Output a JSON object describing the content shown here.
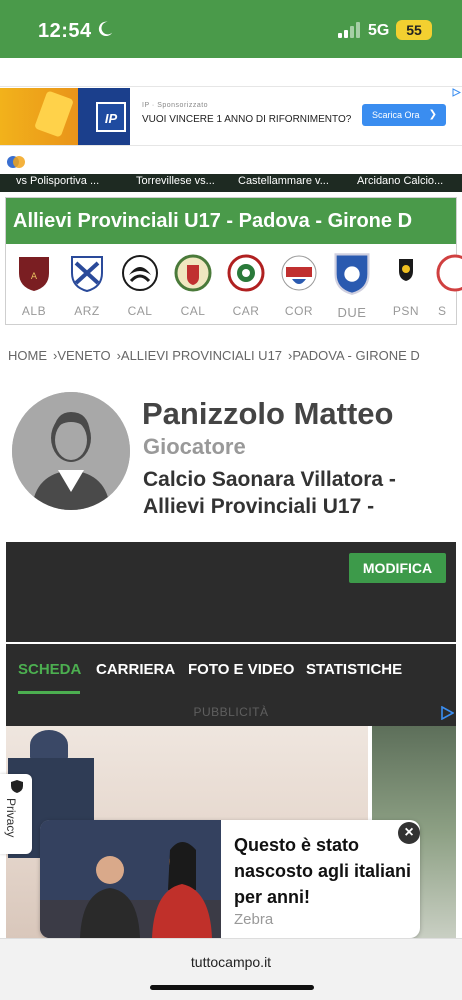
{
  "status_bar": {
    "time": "12:54",
    "network": "5G",
    "battery": "55"
  },
  "ad_banner": {
    "sponsor_label": "IP · Sponsorizzato",
    "headline": "VUOI VINCERE 1 ANNO DI RIFORNIMENTO?",
    "cta": "Scarica Ora",
    "logo_text": "IP"
  },
  "ticker": {
    "items": [
      "vs Polisportiva ...",
      "Torrevillese vs...",
      "Castellammare v...",
      "Arcidano Calcio..."
    ]
  },
  "league": {
    "title_bold": "Allievi Provinciali U17",
    "title_rest": " - Padova - Girone D",
    "teams": [
      {
        "code": "ALB",
        "color": "#7a1e22"
      },
      {
        "code": "ARZ",
        "color": "#2a4a9a"
      },
      {
        "code": "CAL",
        "color": "#1a1a1a"
      },
      {
        "code": "CAL",
        "color": "#4a7a3a"
      },
      {
        "code": "CAR",
        "color": "#b02020"
      },
      {
        "code": "COR",
        "color": "#c03030"
      },
      {
        "code": "DUE",
        "color": "#2a5ab0"
      },
      {
        "code": "PSN",
        "color": "#1a1a1a"
      },
      {
        "code": "S",
        "color": "#d04040"
      }
    ]
  },
  "breadcrumb": [
    "HOME",
    "VENETO",
    "ALLIEVI PROVINCIALI U17",
    "PADOVA - GIRONE D"
  ],
  "profile": {
    "name": "Panizzolo Matteo",
    "role": "Giocatore",
    "team": "Calcio Saonara Villatora - Allievi Provinciali U17 -"
  },
  "actions": {
    "edit": "MODIFICA"
  },
  "tabs": [
    {
      "label": "SCHEDA",
      "active": true
    },
    {
      "label": "CARRIERA",
      "active": false
    },
    {
      "label": "FOTO E VIDEO",
      "active": false
    },
    {
      "label": "STATISTICHE",
      "active": false
    }
  ],
  "ad_label": "PUBBLICITÀ",
  "privacy": "Privacy",
  "native_ad": {
    "headline": "Questo è stato nascosto agli italiani per anni!",
    "source": "Zebra"
  },
  "url": "tuttocampo.it",
  "colors": {
    "brand_green": "#4a9a4a",
    "dark_panel": "#2c2c2c",
    "active_tab": "#4caf50"
  }
}
